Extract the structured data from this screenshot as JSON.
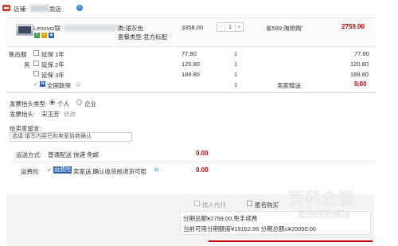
{
  "store": {
    "label": "店铺:",
    "name_suffix": "卖店"
  },
  "item": {
    "title": "Lenovo/联",
    "attr_color": "类:银灰色",
    "attr_package": "套餐类型:官方标配",
    "unit_price": "3358.00",
    "quantity": "1",
    "promo": "省599:淘抢购",
    "subtotal": "2759.00",
    "qty_minus": "-",
    "qty_plus": "+"
  },
  "warranty": {
    "row_label_1": "售后服",
    "row_label_2": "务",
    "options": [
      {
        "label": "延保 1年",
        "price": "77.80",
        "qty": "1",
        "total": "77.80"
      },
      {
        "label": "延保 2年",
        "price": "120.80",
        "qty": "1",
        "total": "120.80"
      },
      {
        "label": "延保 3年",
        "price": "189.80",
        "qty": "1",
        "total": "189.80"
      }
    ],
    "gift": {
      "label": "全国联保",
      "qty": "1",
      "note": "卖家赠送",
      "total": "0.00"
    }
  },
  "invoice": {
    "type_label": "发票抬头类型:",
    "type_personal": "个人",
    "type_company": "企业",
    "title_label": "发票抬头:",
    "title_value": "宋玉芳",
    "edit": "修改"
  },
  "message": {
    "label": "给卖家留言:",
    "value": "选填:填写内容已和卖家协商确认"
  },
  "shipping": {
    "label": "运送方式:",
    "value": "普通配送 快递 免邮",
    "price": "0.00",
    "insurance_label": "运费险:",
    "insurance_tag": "运费险",
    "insurance_text": "卖家送,确认收货前退货可赔",
    "insurance_price": "0.00"
  },
  "summary": {
    "pay_for_other": "找人代付",
    "anonymous": "匿名购买",
    "installment": "分期总额¥2759.00,免手续费",
    "limit": "当前可用分期额度¥19162.96 分期总额≤¥20000.00"
  },
  "watermark": {
    "big": "百科全说",
    "small": "助你轻松解决"
  }
}
